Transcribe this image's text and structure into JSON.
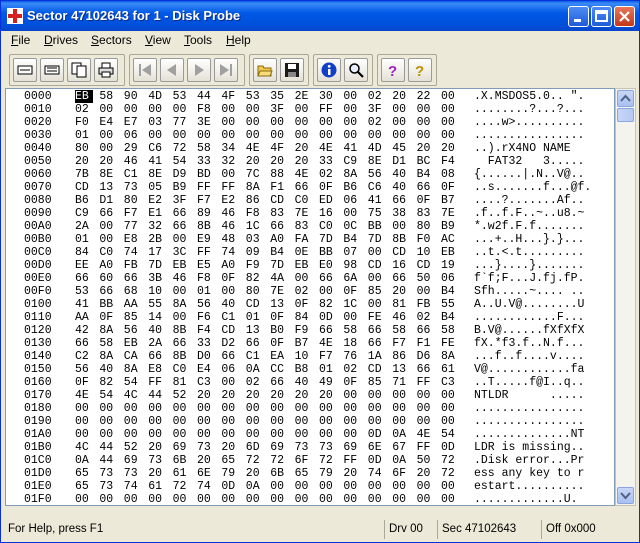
{
  "window": {
    "title": "Sector 47102643 for 1 - Disk Probe",
    "buttons": [
      "minimize",
      "maximize",
      "close"
    ]
  },
  "menu": {
    "items": [
      {
        "label": "File",
        "accel": "F",
        "rest": "ile"
      },
      {
        "label": "Drives",
        "accel": "D",
        "rest": "rives"
      },
      {
        "label": "Sectors",
        "accel": "S",
        "rest": "ectors"
      },
      {
        "label": "View",
        "accel": "V",
        "rest": "iew"
      },
      {
        "label": "Tools",
        "accel": "T",
        "rest": "ools"
      },
      {
        "label": "Help",
        "accel": "H",
        "rest": "elp"
      }
    ]
  },
  "toolbar": {
    "groups": [
      [
        "read-sector-icon",
        "write-sector-icon",
        "copy-sector-icon",
        "print-icon"
      ],
      [
        "first-sector-icon",
        "previous-sector-icon",
        "next-sector-icon",
        "last-sector-icon"
      ],
      [
        "open-folder-icon",
        "save-disk-icon"
      ],
      [
        "info-icon",
        "search-icon"
      ],
      [
        "help-icon",
        "context-help-icon"
      ]
    ]
  },
  "hex_view": {
    "selected": {
      "row": 0,
      "col": 0
    },
    "rows": [
      {
        "addr": "0000",
        "bytes": [
          "EB",
          "58",
          "90",
          "4D",
          "53",
          "44",
          "4F",
          "53",
          "35",
          "2E",
          "30",
          "00",
          "02",
          "20",
          "22",
          "00"
        ],
        "ascii": ".X.MSDOS5.0.. \"."
      },
      {
        "addr": "0010",
        "bytes": [
          "02",
          "00",
          "00",
          "00",
          "00",
          "F8",
          "00",
          "00",
          "3F",
          "00",
          "FF",
          "00",
          "3F",
          "00",
          "00",
          "00"
        ],
        "ascii": "........?...?..."
      },
      {
        "addr": "0020",
        "bytes": [
          "F0",
          "E4",
          "E7",
          "03",
          "77",
          "3E",
          "00",
          "00",
          "00",
          "00",
          "00",
          "00",
          "02",
          "00",
          "00",
          "00"
        ],
        "ascii": "....w>.........."
      },
      {
        "addr": "0030",
        "bytes": [
          "01",
          "00",
          "06",
          "00",
          "00",
          "00",
          "00",
          "00",
          "00",
          "00",
          "00",
          "00",
          "00",
          "00",
          "00",
          "00"
        ],
        "ascii": "................"
      },
      {
        "addr": "0040",
        "bytes": [
          "80",
          "00",
          "29",
          "C6",
          "72",
          "58",
          "34",
          "4E",
          "4F",
          "20",
          "4E",
          "41",
          "4D",
          "45",
          "20",
          "20"
        ],
        "ascii": "..).rX4NO NAME  "
      },
      {
        "addr": "0050",
        "bytes": [
          "20",
          "20",
          "46",
          "41",
          "54",
          "33",
          "32",
          "20",
          "20",
          "20",
          "33",
          "C9",
          "8E",
          "D1",
          "BC",
          "F4"
        ],
        "ascii": "  FAT32   3....."
      },
      {
        "addr": "0060",
        "bytes": [
          "7B",
          "8E",
          "C1",
          "8E",
          "D9",
          "BD",
          "00",
          "7C",
          "88",
          "4E",
          "02",
          "8A",
          "56",
          "40",
          "B4",
          "08"
        ],
        "ascii": "{......|.N..V@.."
      },
      {
        "addr": "0070",
        "bytes": [
          "CD",
          "13",
          "73",
          "05",
          "B9",
          "FF",
          "FF",
          "8A",
          "F1",
          "66",
          "0F",
          "B6",
          "C6",
          "40",
          "66",
          "0F"
        ],
        "ascii": "..s.......f...@f."
      },
      {
        "addr": "0080",
        "bytes": [
          "B6",
          "D1",
          "80",
          "E2",
          "3F",
          "F7",
          "E2",
          "86",
          "CD",
          "C0",
          "ED",
          "06",
          "41",
          "66",
          "0F",
          "B7"
        ],
        "ascii": "....?.......Af.."
      },
      {
        "addr": "0090",
        "bytes": [
          "C9",
          "66",
          "F7",
          "E1",
          "66",
          "89",
          "46",
          "F8",
          "83",
          "7E",
          "16",
          "00",
          "75",
          "38",
          "83",
          "7E"
        ],
        "ascii": ".f..f.F..~..u8.~"
      },
      {
        "addr": "00A0",
        "bytes": [
          "2A",
          "00",
          "77",
          "32",
          "66",
          "8B",
          "46",
          "1C",
          "66",
          "83",
          "C0",
          "0C",
          "BB",
          "00",
          "80",
          "B9"
        ],
        "ascii": "*.w2f.F.f......."
      },
      {
        "addr": "00B0",
        "bytes": [
          "01",
          "00",
          "E8",
          "2B",
          "00",
          "E9",
          "48",
          "03",
          "A0",
          "FA",
          "7D",
          "B4",
          "7D",
          "8B",
          "F0",
          "AC"
        ],
        "ascii": "...+..H...}.}..."
      },
      {
        "addr": "00C0",
        "bytes": [
          "84",
          "C0",
          "74",
          "17",
          "3C",
          "FF",
          "74",
          "09",
          "B4",
          "0E",
          "BB",
          "07",
          "00",
          "CD",
          "10",
          "EB"
        ],
        "ascii": "..t.<.t........."
      },
      {
        "addr": "00D0",
        "bytes": [
          "EE",
          "A0",
          "FB",
          "7D",
          "EB",
          "E5",
          "A0",
          "F9",
          "7D",
          "EB",
          "E0",
          "98",
          "CD",
          "16",
          "CD",
          "19"
        ],
        "ascii": "...}....}......."
      },
      {
        "addr": "00E0",
        "bytes": [
          "66",
          "60",
          "66",
          "3B",
          "46",
          "F8",
          "0F",
          "82",
          "4A",
          "00",
          "66",
          "6A",
          "00",
          "66",
          "50",
          "06"
        ],
        "ascii": "f`f;F...J.fj.fP."
      },
      {
        "addr": "00F0",
        "bytes": [
          "53",
          "66",
          "68",
          "10",
          "00",
          "01",
          "00",
          "80",
          "7E",
          "02",
          "00",
          "0F",
          "85",
          "20",
          "00",
          "B4"
        ],
        "ascii": "Sfh.....~.... .."
      },
      {
        "addr": "0100",
        "bytes": [
          "41",
          "BB",
          "AA",
          "55",
          "8A",
          "56",
          "40",
          "CD",
          "13",
          "0F",
          "82",
          "1C",
          "00",
          "81",
          "FB",
          "55"
        ],
        "ascii": "A..U.V@........U"
      },
      {
        "addr": "0110",
        "bytes": [
          "AA",
          "0F",
          "85",
          "14",
          "00",
          "F6",
          "C1",
          "01",
          "0F",
          "84",
          "0D",
          "00",
          "FE",
          "46",
          "02",
          "B4"
        ],
        "ascii": "............F..."
      },
      {
        "addr": "0120",
        "bytes": [
          "42",
          "8A",
          "56",
          "40",
          "8B",
          "F4",
          "CD",
          "13",
          "B0",
          "F9",
          "66",
          "58",
          "66",
          "58",
          "66",
          "58"
        ],
        "ascii": "B.V@......fXfXfX"
      },
      {
        "addr": "0130",
        "bytes": [
          "66",
          "58",
          "EB",
          "2A",
          "66",
          "33",
          "D2",
          "66",
          "0F",
          "B7",
          "4E",
          "18",
          "66",
          "F7",
          "F1",
          "FE"
        ],
        "ascii": "fX.*f3.f..N.f..."
      },
      {
        "addr": "0140",
        "bytes": [
          "C2",
          "8A",
          "CA",
          "66",
          "8B",
          "D0",
          "66",
          "C1",
          "EA",
          "10",
          "F7",
          "76",
          "1A",
          "86",
          "D6",
          "8A"
        ],
        "ascii": "...f..f....v...."
      },
      {
        "addr": "0150",
        "bytes": [
          "56",
          "40",
          "8A",
          "E8",
          "C0",
          "E4",
          "06",
          "0A",
          "CC",
          "B8",
          "01",
          "02",
          "CD",
          "13",
          "66",
          "61"
        ],
        "ascii": "V@............fa"
      },
      {
        "addr": "0160",
        "bytes": [
          "0F",
          "82",
          "54",
          "FF",
          "81",
          "C3",
          "00",
          "02",
          "66",
          "40",
          "49",
          "0F",
          "85",
          "71",
          "FF",
          "C3"
        ],
        "ascii": "..T.....f@I..q.."
      },
      {
        "addr": "0170",
        "bytes": [
          "4E",
          "54",
          "4C",
          "44",
          "52",
          "20",
          "20",
          "20",
          "20",
          "20",
          "20",
          "00",
          "00",
          "00",
          "00",
          "00"
        ],
        "ascii": "NTLDR      ....."
      },
      {
        "addr": "0180",
        "bytes": [
          "00",
          "00",
          "00",
          "00",
          "00",
          "00",
          "00",
          "00",
          "00",
          "00",
          "00",
          "00",
          "00",
          "00",
          "00",
          "00"
        ],
        "ascii": "................"
      },
      {
        "addr": "0190",
        "bytes": [
          "00",
          "00",
          "00",
          "00",
          "00",
          "00",
          "00",
          "00",
          "00",
          "00",
          "00",
          "00",
          "00",
          "00",
          "00",
          "00"
        ],
        "ascii": "................"
      },
      {
        "addr": "01A0",
        "bytes": [
          "00",
          "00",
          "00",
          "00",
          "00",
          "00",
          "00",
          "00",
          "00",
          "00",
          "00",
          "00",
          "0D",
          "0A",
          "4E",
          "54"
        ],
        "ascii": "..............NT"
      },
      {
        "addr": "01B0",
        "bytes": [
          "4C",
          "44",
          "52",
          "20",
          "69",
          "73",
          "20",
          "6D",
          "69",
          "73",
          "73",
          "69",
          "6E",
          "67",
          "FF",
          "0D"
        ],
        "ascii": "LDR is missing.."
      },
      {
        "addr": "01C0",
        "bytes": [
          "0A",
          "44",
          "69",
          "73",
          "6B",
          "20",
          "65",
          "72",
          "72",
          "6F",
          "72",
          "FF",
          "0D",
          "0A",
          "50",
          "72"
        ],
        "ascii": ".Disk error...Pr"
      },
      {
        "addr": "01D0",
        "bytes": [
          "65",
          "73",
          "73",
          "20",
          "61",
          "6E",
          "79",
          "20",
          "6B",
          "65",
          "79",
          "20",
          "74",
          "6F",
          "20",
          "72"
        ],
        "ascii": "ess any key to r"
      },
      {
        "addr": "01E0",
        "bytes": [
          "65",
          "73",
          "74",
          "61",
          "72",
          "74",
          "0D",
          "0A",
          "00",
          "00",
          "00",
          "00",
          "00",
          "00",
          "00",
          "00"
        ],
        "ascii": "estart.........."
      },
      {
        "addr": "01F0",
        "bytes": [
          "00",
          "00",
          "00",
          "00",
          "00",
          "00",
          "00",
          "00",
          "00",
          "00",
          "00",
          "00",
          "00",
          "00",
          "00",
          "00"
        ],
        "ascii": ".............U."
      }
    ]
  },
  "status": {
    "help": "For Help, press F1",
    "drive": "Drv  00",
    "sector": "Sec 47102643",
    "offset": "Off 0x000"
  }
}
